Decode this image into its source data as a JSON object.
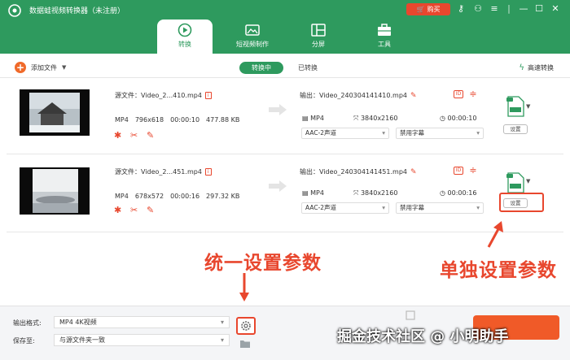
{
  "app": {
    "title": "数据蛙视频转换器（未注册）",
    "buy_label": "购买",
    "colors": {
      "brand": "#2e9a5e",
      "accent": "#e8472e",
      "convert": "#f05a28"
    }
  },
  "tabs": [
    {
      "label": "转换",
      "icon": "convert-icon",
      "active": true
    },
    {
      "label": "短视频制作",
      "icon": "video-make-icon",
      "active": false
    },
    {
      "label": "分屏",
      "icon": "split-screen-icon",
      "active": false
    },
    {
      "label": "工具",
      "icon": "toolbox-icon",
      "active": false
    }
  ],
  "toolbar": {
    "add_label": "添加文件",
    "seg_converting": "转换中",
    "seg_converted": "已转换",
    "fast_label": "高速转换"
  },
  "items": [
    {
      "source": "源文件：Video_2...410.mp4",
      "src_format": "MP4",
      "src_resolution": "796x618",
      "src_duration": "00:00:10",
      "src_size": "477.88 KB",
      "output": "输出：Video_240304141410.mp4",
      "out_format": "MP4",
      "out_resolution": "3840x2160",
      "out_duration": "00:00:10",
      "audio": "AAC-2声道",
      "subtitle": "禁用字幕",
      "settings_label": "设置"
    },
    {
      "source": "源文件：Video_2...451.mp4",
      "src_format": "MP4",
      "src_resolution": "678x572",
      "src_duration": "00:00:16",
      "src_size": "297.32 KB",
      "output": "输出：Video_240304141451.mp4",
      "out_format": "MP4",
      "out_resolution": "3840x2160",
      "out_duration": "00:00:16",
      "audio": "AAC-2声道",
      "subtitle": "禁用字幕",
      "settings_label": "设置"
    }
  ],
  "bottom": {
    "format_label": "输出格式:",
    "format_value": "MP4 4K视频",
    "save_label": "保存至:",
    "save_value": "与源文件夹一致"
  },
  "annotations": {
    "left": "统一设置参数",
    "right": "单独设置参数",
    "watermark": "掘金技术社区 @ 小明助手"
  }
}
